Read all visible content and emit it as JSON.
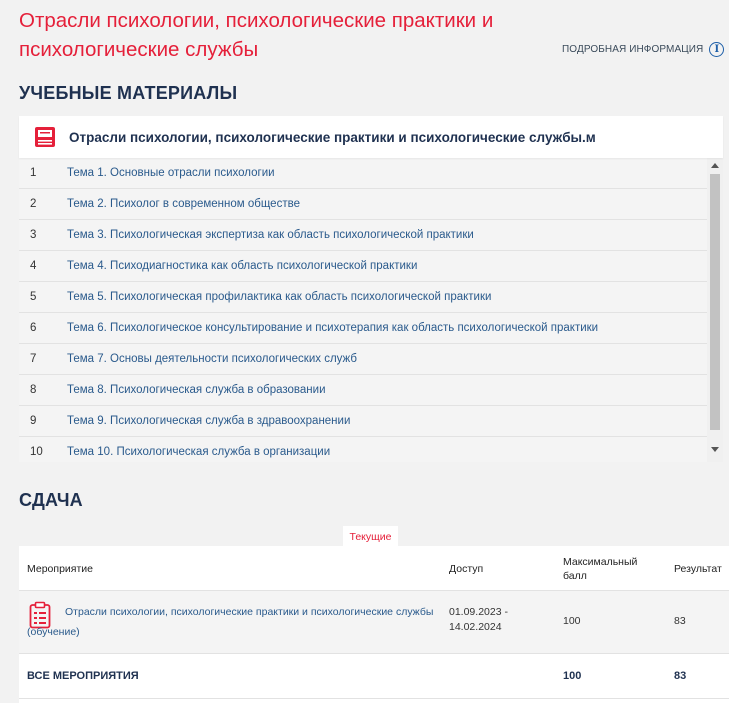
{
  "page": {
    "title": "Отрасли психологии, психологические практики и психологические службы",
    "info_link": "ПОДРОБНАЯ ИНФОРМАЦИЯ"
  },
  "materials": {
    "section_title": "УЧЕБНЫЕ МАТЕРИАЛЫ",
    "header": "Отрасли психологии, психологические практики и психологические службы.м",
    "items": [
      {
        "num": "1",
        "label": "Тема 1. Основные отрасли психологии"
      },
      {
        "num": "2",
        "label": "Тема 2. Психолог в современном обществе"
      },
      {
        "num": "3",
        "label": "Тема 3. Психологическая экспертиза как область психологической практики"
      },
      {
        "num": "4",
        "label": "Тема 4. Психодиагностика как область психологической практики"
      },
      {
        "num": "5",
        "label": "Тема 5. Психологическая профилактика как область психологической практики"
      },
      {
        "num": "6",
        "label": "Тема 6. Психологическое консультирование и психотерапия как область психологической практики"
      },
      {
        "num": "7",
        "label": "Тема 7. Основы деятельности психологических служб"
      },
      {
        "num": "8",
        "label": "Тема 8. Психологическая служба в образовании"
      },
      {
        "num": "9",
        "label": "Тема 9. Психологическая служба в здравоохранении"
      },
      {
        "num": "10",
        "label": "Тема 10. Психологическая служба в организации"
      }
    ]
  },
  "submission": {
    "section_title": "СДАЧА",
    "tab": "Текущие",
    "columns": {
      "event": "Мероприятие",
      "access": "Доступ",
      "max_score_1": "Максимальный",
      "max_score_2": "балл",
      "result": "Результат"
    },
    "row": {
      "title": "Отрасли психологии, психологические практики и психологические службы",
      "subtitle": "(обучение)",
      "access_1": "01.09.2023 -",
      "access_2": "14.02.2024",
      "max_score": "100",
      "result": "83"
    },
    "total": {
      "label": "ВСЕ МЕРОПРИЯТИЯ",
      "max_score": "100",
      "result": "83"
    }
  },
  "colors": {
    "accent": "#e5203a",
    "link": "#2a5a8c",
    "heading": "#1f3150"
  },
  "icons": [
    "info-icon",
    "book-icon",
    "clipboard-icon"
  ]
}
